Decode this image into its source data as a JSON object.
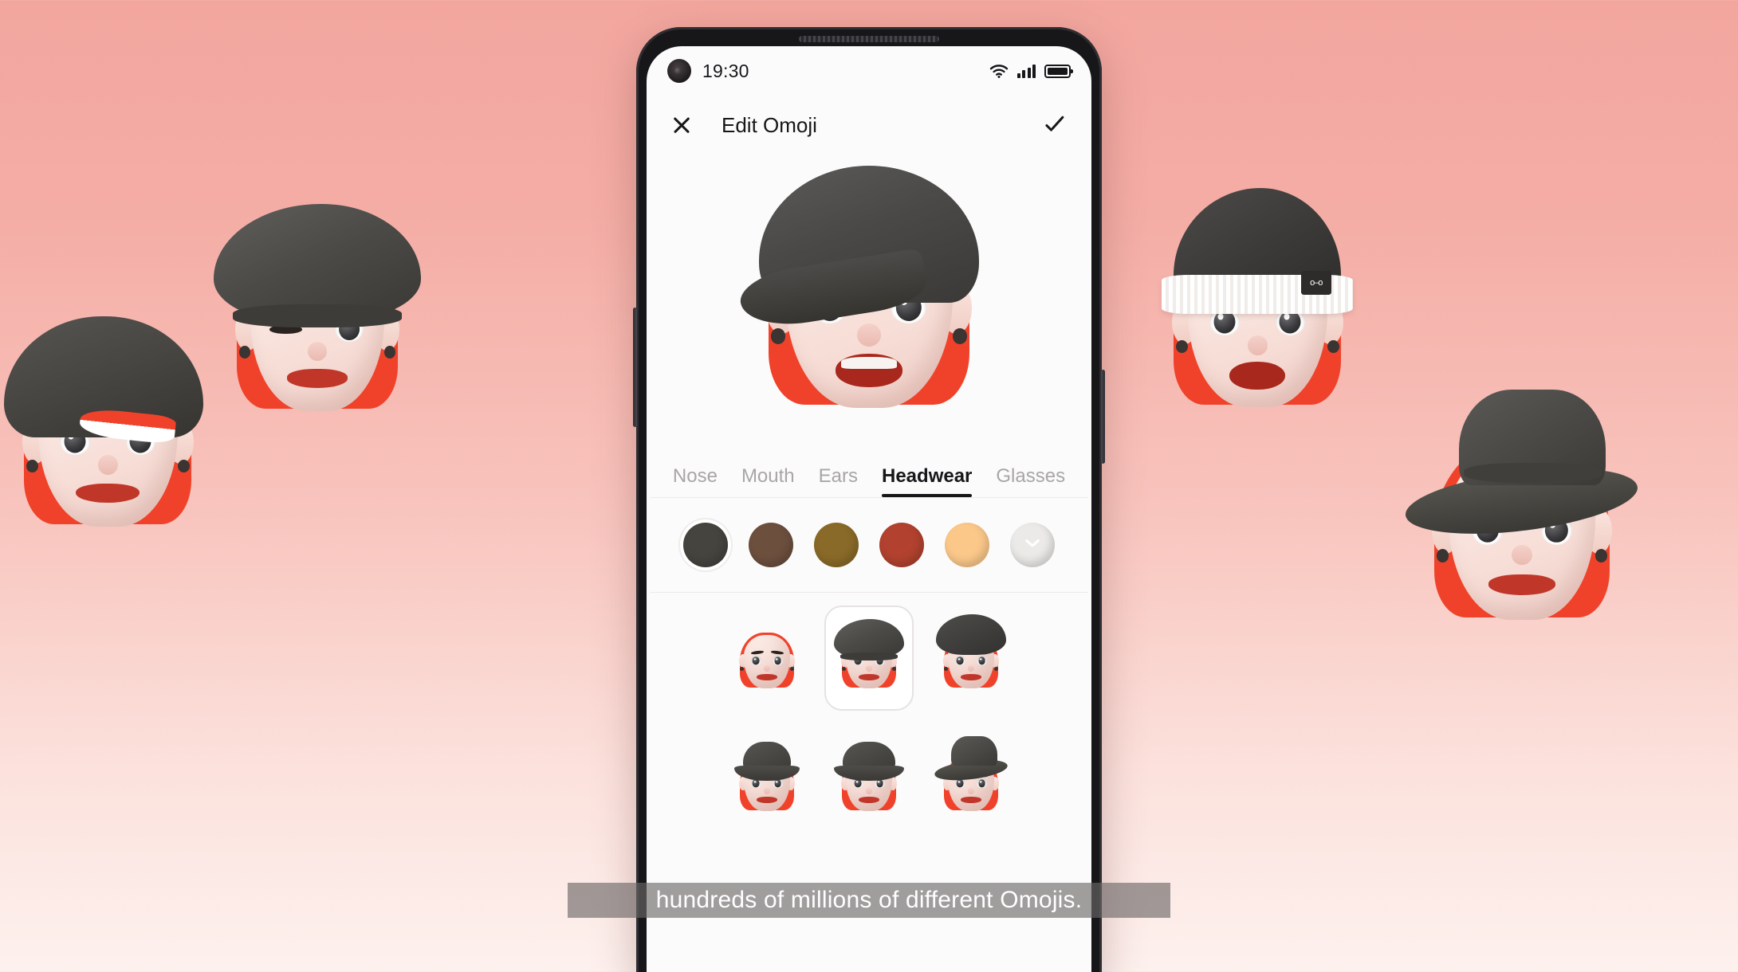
{
  "background": {
    "gradient_top": "#f2a69e",
    "gradient_bottom": "#fdf1ee",
    "avatars": [
      {
        "name": "snapback-cap-avatar",
        "headwear": "snapback cap"
      },
      {
        "name": "beret-avatar",
        "headwear": "beret"
      },
      {
        "name": "beanie-avatar",
        "headwear": "cuffed beanie"
      },
      {
        "name": "fedora-avatar",
        "headwear": "fedora"
      }
    ]
  },
  "phone": {
    "statusbar": {
      "time": "19:30",
      "wifi_icon": "wifi-icon",
      "signal_icon": "signal-bars-icon",
      "signal_bars": 4,
      "battery_icon": "battery-full-icon"
    },
    "header": {
      "close_icon": "close-icon",
      "title": "Edit Omoji",
      "confirm_icon": "checkmark-icon"
    },
    "preview": {
      "name": "omoji-preview",
      "headwear": "baseball cap",
      "hair_color": "#f0422a",
      "expression": "smiling"
    },
    "tabs": [
      {
        "label": "Nose",
        "active": false
      },
      {
        "label": "Mouth",
        "active": false
      },
      {
        "label": "Ears",
        "active": false
      },
      {
        "label": "Headwear",
        "active": true
      },
      {
        "label": "Glasses",
        "active": false
      }
    ],
    "colors": {
      "selected_index": 0,
      "swatches": [
        {
          "name": "charcoal",
          "hex": "#46443f",
          "selected": true
        },
        {
          "name": "brown",
          "hex": "#6d4f3e",
          "selected": false
        },
        {
          "name": "olive-gold",
          "hex": "#8a6a28",
          "selected": false
        },
        {
          "name": "brick-red",
          "hex": "#b2422f",
          "selected": false
        },
        {
          "name": "peach",
          "hex": "#fbc88a",
          "selected": false
        }
      ],
      "more_button": {
        "name": "expand-colors-button",
        "icon": "chevron-down-icon",
        "bg": "#eceae8"
      }
    },
    "headwear_options": {
      "row1": [
        {
          "name": "option-none",
          "label": "None",
          "selected": false
        },
        {
          "name": "option-flat-cap",
          "label": "Flat cap",
          "selected": true
        },
        {
          "name": "option-beret",
          "label": "Beret",
          "selected": false
        }
      ],
      "row2": [
        {
          "name": "option-bucket-hat",
          "label": "Bucket hat",
          "selected": false
        },
        {
          "name": "option-bucket-hat-2",
          "label": "Bucket hat 2",
          "selected": false
        },
        {
          "name": "option-fedora",
          "label": "Fedora",
          "selected": false
        }
      ]
    }
  },
  "caption": {
    "text": "hundreds of millions of different Omojis."
  }
}
